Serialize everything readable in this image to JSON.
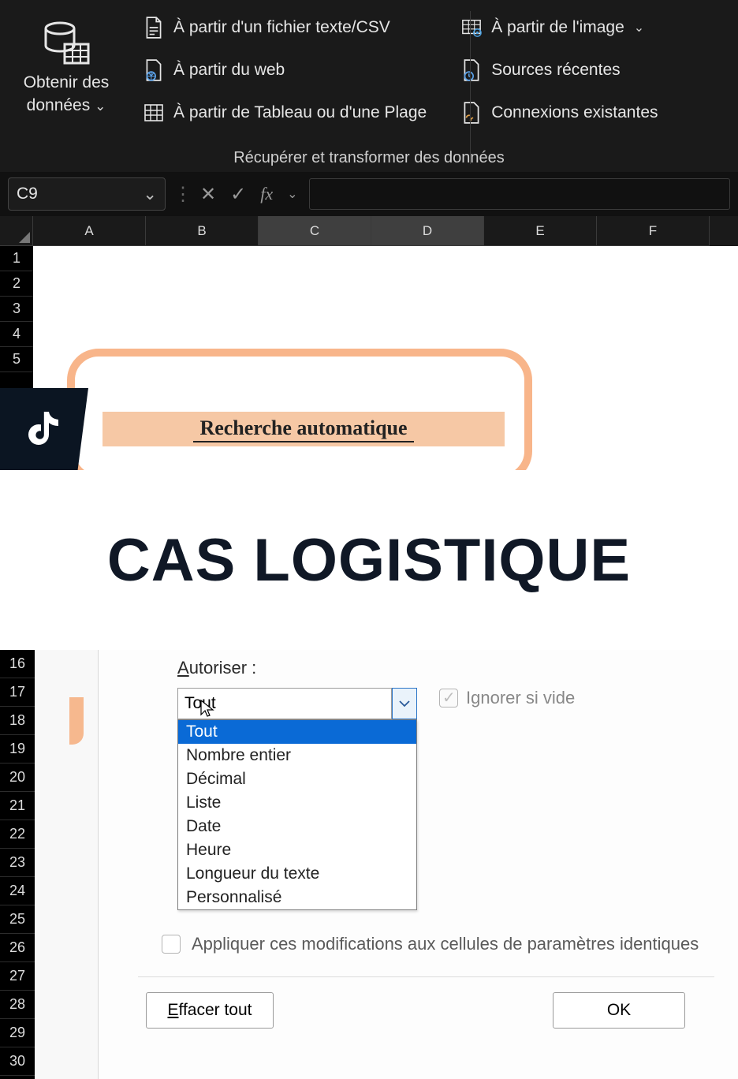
{
  "ribbon": {
    "get_data_line1": "Obtenir des",
    "get_data_line2": "données",
    "from_textcsv": "À partir d'un fichier texte/CSV",
    "from_web": "À partir du web",
    "from_table": "À partir de Tableau ou d'une Plage",
    "from_image": "À partir de l'image",
    "recent_sources": "Sources récentes",
    "existing_connections": "Connexions existantes",
    "group_caption": "Récupérer et transformer des données"
  },
  "formula": {
    "name_box": "C9",
    "fx": "fx"
  },
  "columns": [
    "A",
    "B",
    "C",
    "D",
    "E",
    "F"
  ],
  "rows_top": [
    "1",
    "2",
    "3",
    "4",
    "5"
  ],
  "card": {
    "title": "Recherche automatique"
  },
  "overlay": {
    "title": "CAS LOGISTIQUE"
  },
  "rows_bottom": [
    "16",
    "17",
    "18",
    "19",
    "20",
    "21",
    "22",
    "23",
    "24",
    "25",
    "26",
    "27",
    "28",
    "29",
    "30"
  ],
  "dialog": {
    "allow_prefix": "A",
    "allow_rest": "utoriser :",
    "allow_value": "Tout",
    "ignore_label": "Ignorer si vide",
    "options": [
      "Tout",
      "Nombre entier",
      "Décimal",
      "Liste",
      "Date",
      "Heure",
      "Longueur du texte",
      "Personnalisé"
    ],
    "apply_label": "Appliquer ces modifications aux cellules de paramètres identiques",
    "clear_prefix": "E",
    "clear_rest": "ffacer tout",
    "ok_label": "OK"
  }
}
